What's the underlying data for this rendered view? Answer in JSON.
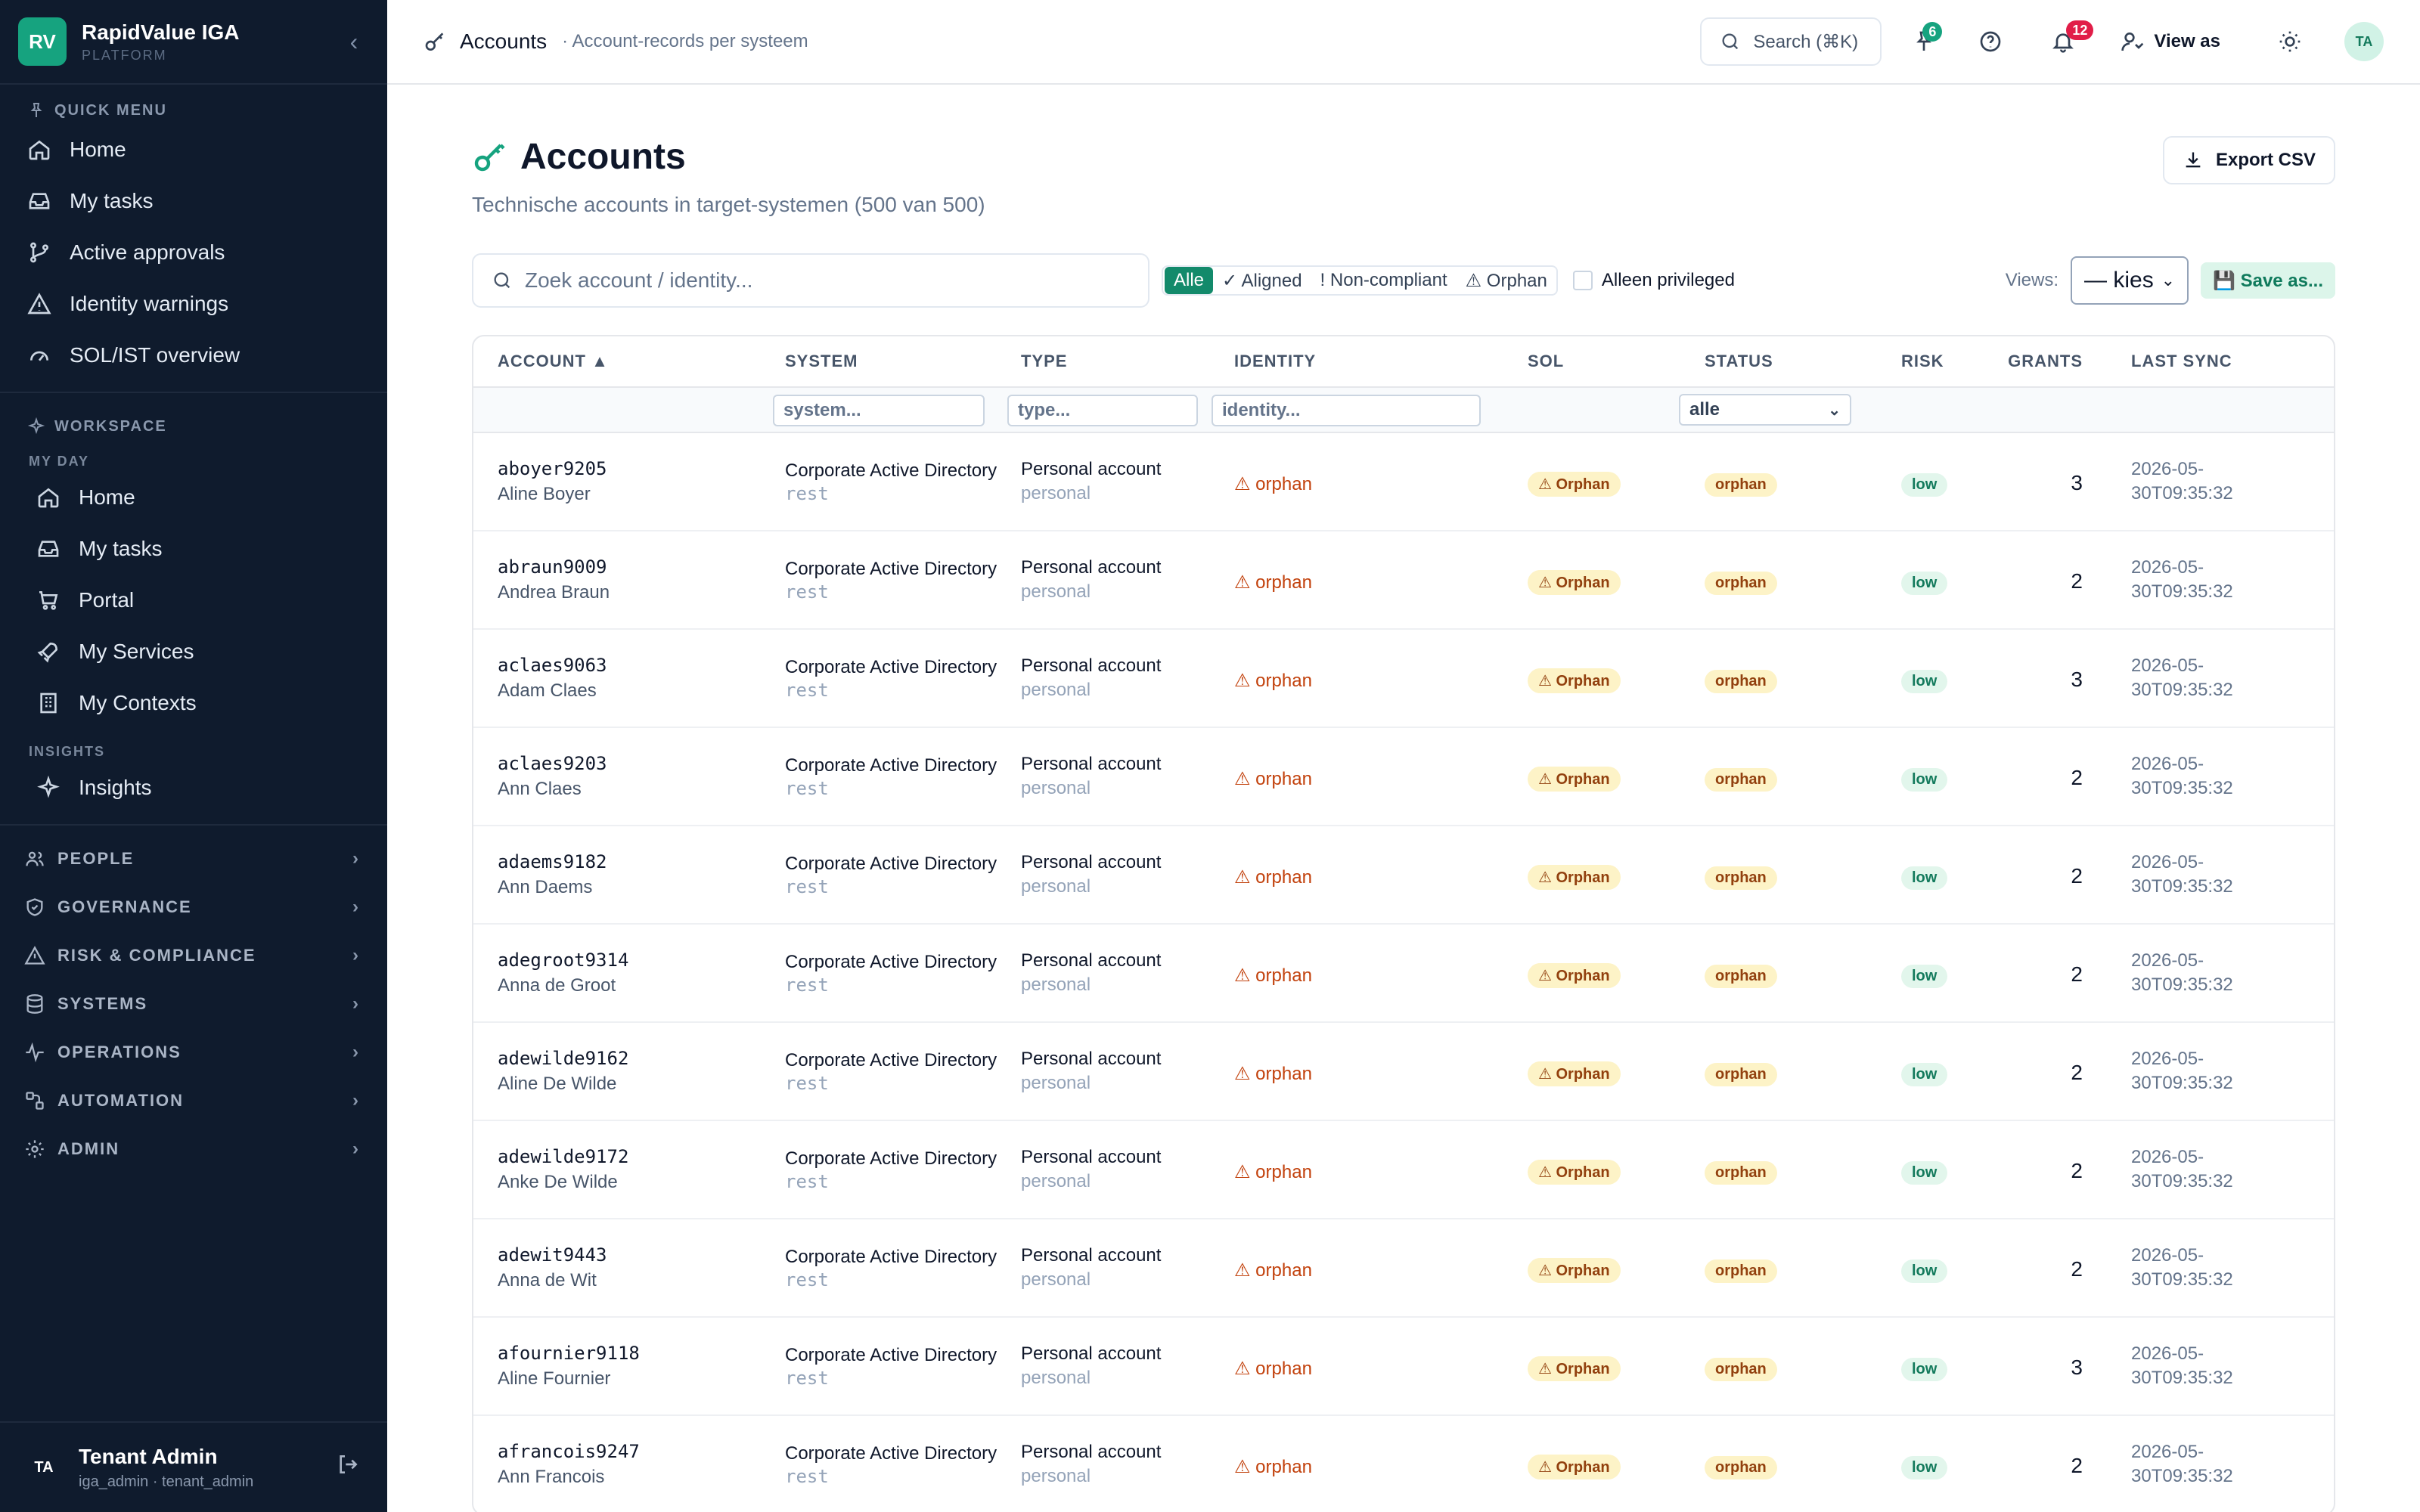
{
  "brand": {
    "logo": "RV",
    "name": "RapidValue IGA",
    "sub": "PLATFORM"
  },
  "quick_menu": {
    "label": "QUICK MENU",
    "items": [
      "Home",
      "My tasks",
      "Active approvals",
      "Identity warnings",
      "SOL/IST overview"
    ]
  },
  "workspace": {
    "label": "WORKSPACE",
    "my_day_label": "MY DAY",
    "my_day_items": [
      "Home",
      "My tasks",
      "Portal",
      "My Services",
      "My Contexts"
    ],
    "insights_label": "INSIGHTS",
    "insights_items": [
      "Insights"
    ]
  },
  "groups": [
    "PEOPLE",
    "GOVERNANCE",
    "RISK & COMPLIANCE",
    "SYSTEMS",
    "OPERATIONS",
    "AUTOMATION",
    "ADMIN"
  ],
  "user": {
    "initials": "TA",
    "name": "Tenant Admin",
    "meta": "iga_admin · tenant_admin"
  },
  "topbar": {
    "title": "Accounts",
    "subtitle": "· Account-records per systeem",
    "search_label": "Search (⌘K)",
    "pinned_count": "6",
    "notif_count": "12",
    "view_as": "View as",
    "avatar": "TA"
  },
  "page": {
    "title": "Accounts",
    "subtitle": "Technische accounts in target-systemen (500 van 500)",
    "export_label": "Export CSV"
  },
  "filters": {
    "search_placeholder": "Zoek account / identity...",
    "segments": [
      "Alle",
      "✓ Aligned",
      "! Non-compliant",
      "⚠ Orphan"
    ],
    "privileged_label": "Alleen privileged",
    "views_label": "Views:",
    "views_value": "— kies —",
    "save_as": "💾 Save as..."
  },
  "table": {
    "columns": [
      "ACCOUNT ▲",
      "SYSTEM",
      "TYPE",
      "IDENTITY",
      "SOL",
      "STATUS",
      "RISK",
      "GRANTS",
      "LAST SYNC"
    ],
    "filter_placeholders": {
      "system": "system...",
      "type": "type...",
      "identity": "identity..."
    },
    "status_filter": "alle",
    "rows": [
      {
        "account": "aboyer9205",
        "name": "Aline Boyer",
        "system": "Corporate Active Directory",
        "sys_kind": "rest",
        "type": "Personal account",
        "type_kind": "personal",
        "identity": "⚠ orphan",
        "sol": "⚠ Orphan",
        "status": "orphan",
        "risk": "low",
        "grants": "3",
        "sync": "2026-05-30T09:35:32"
      },
      {
        "account": "abraun9009",
        "name": "Andrea Braun",
        "system": "Corporate Active Directory",
        "sys_kind": "rest",
        "type": "Personal account",
        "type_kind": "personal",
        "identity": "⚠ orphan",
        "sol": "⚠ Orphan",
        "status": "orphan",
        "risk": "low",
        "grants": "2",
        "sync": "2026-05-30T09:35:32"
      },
      {
        "account": "aclaes9063",
        "name": "Adam Claes",
        "system": "Corporate Active Directory",
        "sys_kind": "rest",
        "type": "Personal account",
        "type_kind": "personal",
        "identity": "⚠ orphan",
        "sol": "⚠ Orphan",
        "status": "orphan",
        "risk": "low",
        "grants": "3",
        "sync": "2026-05-30T09:35:32"
      },
      {
        "account": "aclaes9203",
        "name": "Ann Claes",
        "system": "Corporate Active Directory",
        "sys_kind": "rest",
        "type": "Personal account",
        "type_kind": "personal",
        "identity": "⚠ orphan",
        "sol": "⚠ Orphan",
        "status": "orphan",
        "risk": "low",
        "grants": "2",
        "sync": "2026-05-30T09:35:32"
      },
      {
        "account": "adaems9182",
        "name": "Ann Daems",
        "system": "Corporate Active Directory",
        "sys_kind": "rest",
        "type": "Personal account",
        "type_kind": "personal",
        "identity": "⚠ orphan",
        "sol": "⚠ Orphan",
        "status": "orphan",
        "risk": "low",
        "grants": "2",
        "sync": "2026-05-30T09:35:32"
      },
      {
        "account": "adegroot9314",
        "name": "Anna de Groot",
        "system": "Corporate Active Directory",
        "sys_kind": "rest",
        "type": "Personal account",
        "type_kind": "personal",
        "identity": "⚠ orphan",
        "sol": "⚠ Orphan",
        "status": "orphan",
        "risk": "low",
        "grants": "2",
        "sync": "2026-05-30T09:35:32"
      },
      {
        "account": "adewilde9162",
        "name": "Aline De Wilde",
        "system": "Corporate Active Directory",
        "sys_kind": "rest",
        "type": "Personal account",
        "type_kind": "personal",
        "identity": "⚠ orphan",
        "sol": "⚠ Orphan",
        "status": "orphan",
        "risk": "low",
        "grants": "2",
        "sync": "2026-05-30T09:35:32"
      },
      {
        "account": "adewilde9172",
        "name": "Anke De Wilde",
        "system": "Corporate Active Directory",
        "sys_kind": "rest",
        "type": "Personal account",
        "type_kind": "personal",
        "identity": "⚠ orphan",
        "sol": "⚠ Orphan",
        "status": "orphan",
        "risk": "low",
        "grants": "2",
        "sync": "2026-05-30T09:35:32"
      },
      {
        "account": "adewit9443",
        "name": "Anna de Wit",
        "system": "Corporate Active Directory",
        "sys_kind": "rest",
        "type": "Personal account",
        "type_kind": "personal",
        "identity": "⚠ orphan",
        "sol": "⚠ Orphan",
        "status": "orphan",
        "risk": "low",
        "grants": "2",
        "sync": "2026-05-30T09:35:32"
      },
      {
        "account": "afournier9118",
        "name": "Aline Fournier",
        "system": "Corporate Active Directory",
        "sys_kind": "rest",
        "type": "Personal account",
        "type_kind": "personal",
        "identity": "⚠ orphan",
        "sol": "⚠ Orphan",
        "status": "orphan",
        "risk": "low",
        "grants": "3",
        "sync": "2026-05-30T09:35:32"
      },
      {
        "account": "afrancois9247",
        "name": "Ann Francois",
        "system": "Corporate Active Directory",
        "sys_kind": "rest",
        "type": "Personal account",
        "type_kind": "personal",
        "identity": "⚠ orphan",
        "sol": "⚠ Orphan",
        "status": "orphan",
        "risk": "low",
        "grants": "2",
        "sync": "2026-05-30T09:35:32"
      }
    ]
  },
  "colors": {
    "sidebar_bg": "#0f1b2d",
    "accent": "#16a37f",
    "orphan": "#c2410c"
  }
}
